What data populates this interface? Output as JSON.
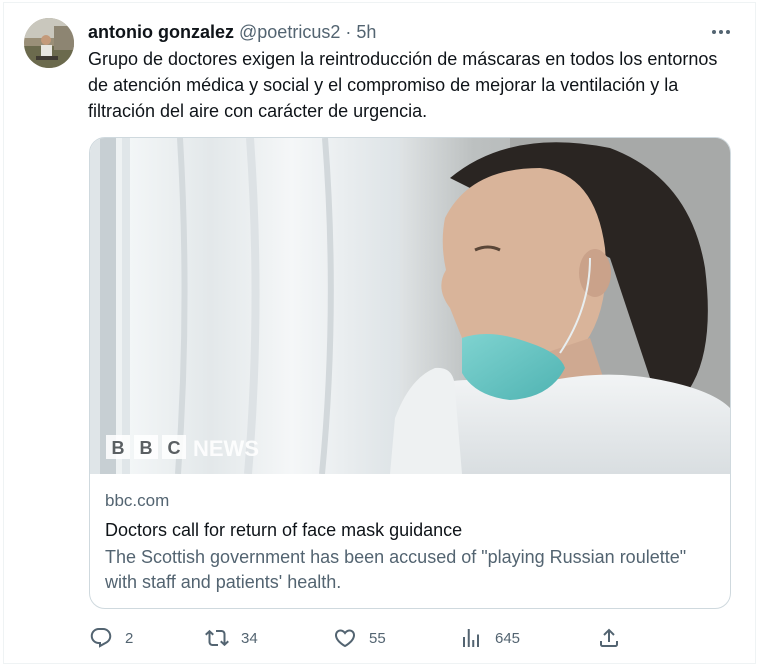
{
  "tweet": {
    "author_name": "antonio gonzalez",
    "handle": "@poetricus2",
    "separator": "·",
    "time": "5h",
    "text": "Grupo de doctores exigen la reintroducción de máscaras en todos los entornos de atención médica y social y el compromiso de mejorar la ventilación y la filtración del aire con carácter de urgencia."
  },
  "card": {
    "image_description": "Woman healthcare worker in white protective suit pulling down a surgical face mask, looking out a window",
    "logo_text_bbc": [
      "B",
      "B",
      "C"
    ],
    "logo_text_news": "NEWS",
    "domain": "bbc.com",
    "title": "Doctors call for return of face mask guidance",
    "description": "The Scottish government has been accused of \"playing Russian roulette\" with staff and patients' health."
  },
  "actions": {
    "replies": "2",
    "retweets": "34",
    "likes": "55",
    "views": "645"
  },
  "icons": {
    "more": "more-icon",
    "reply": "reply-icon",
    "retweet": "retweet-icon",
    "like": "heart-icon",
    "views": "analytics-icon",
    "share": "share-icon"
  },
  "colors": {
    "text": "#0f1419",
    "secondary": "#536471",
    "border": "#cfd9de"
  }
}
